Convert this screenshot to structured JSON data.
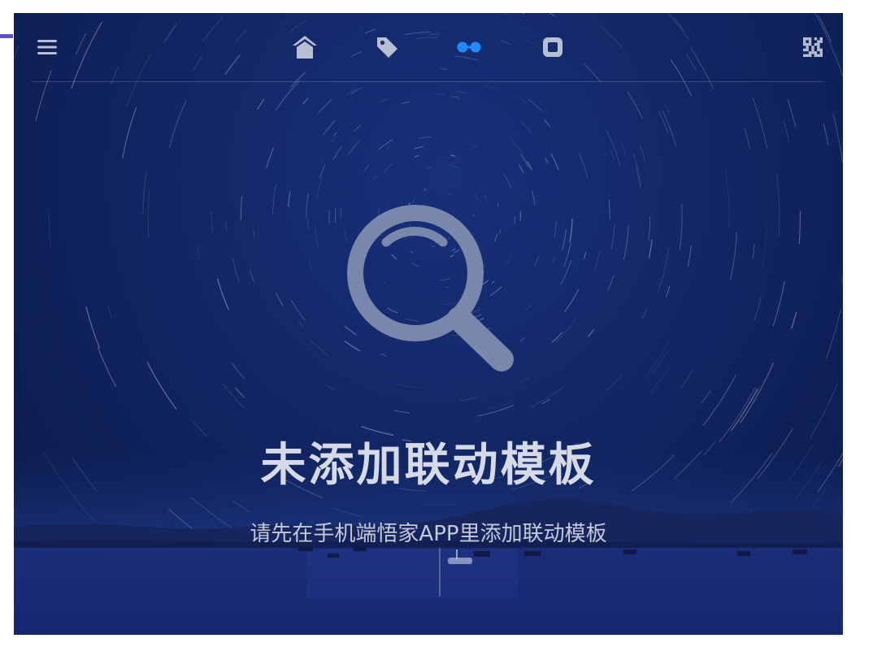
{
  "navbar": {
    "items": [
      {
        "icon": "menu-icon",
        "active": false
      },
      {
        "icon": "home-icon",
        "active": false
      },
      {
        "icon": "tag-icon",
        "active": false
      },
      {
        "icon": "linkage-icon",
        "active": true
      },
      {
        "icon": "square-device-icon",
        "active": false
      },
      {
        "icon": "qr-code-icon",
        "active": false
      }
    ],
    "active_color": "#1e8cff",
    "icon_color": "#b7bfd3"
  },
  "empty_state": {
    "icon": "magnifier-icon",
    "title": "未添加联动模板",
    "subtitle": "请先在手机端悟家APP里添加联动模板"
  },
  "colors": {
    "accent_strip": "#5a4fd6",
    "background": "#142a6c"
  }
}
